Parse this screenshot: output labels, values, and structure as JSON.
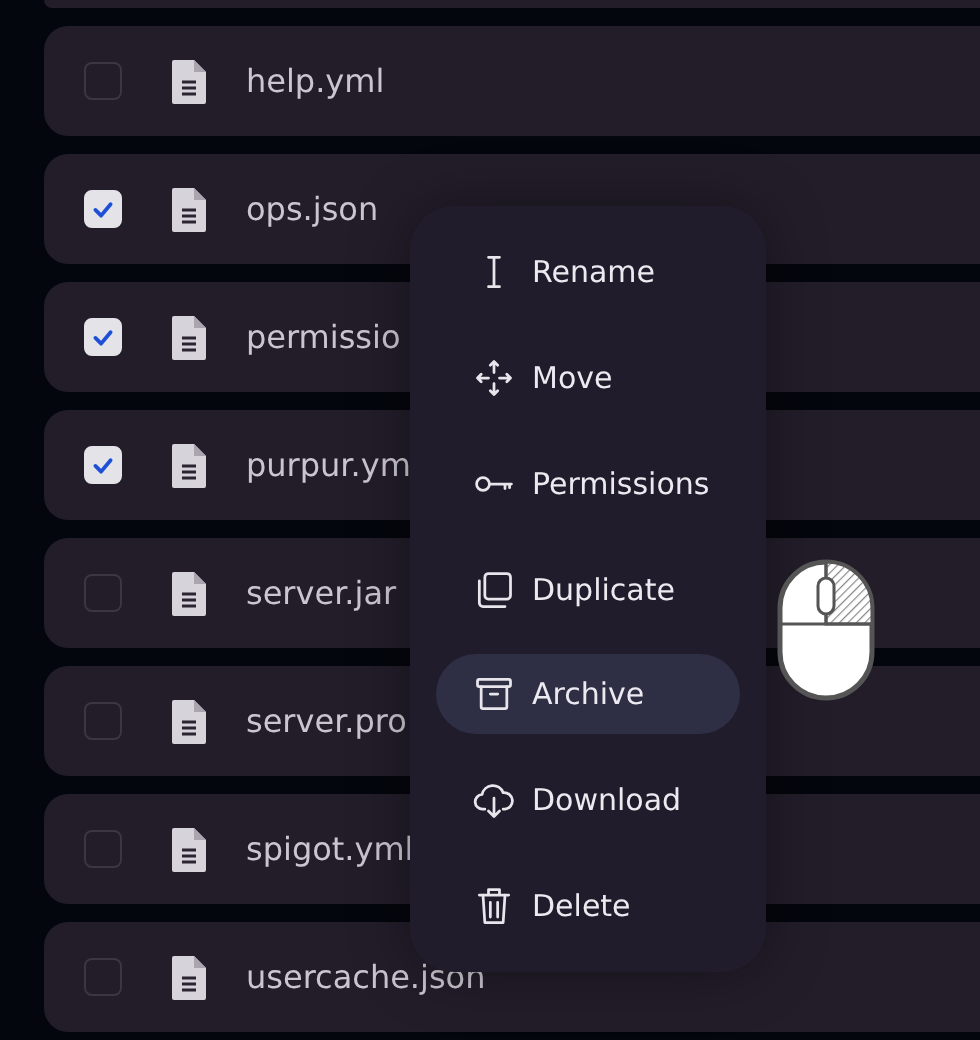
{
  "files": [
    {
      "name": "help.yml",
      "checked": false
    },
    {
      "name": "ops.json",
      "checked": true
    },
    {
      "name": "permissio",
      "checked": true
    },
    {
      "name": "purpur.ym",
      "checked": true
    },
    {
      "name": "server.jar",
      "checked": false
    },
    {
      "name": "server.pro",
      "checked": false
    },
    {
      "name": "spigot.yml",
      "checked": false
    },
    {
      "name": "usercache.json",
      "checked": false
    }
  ],
  "context_menu": [
    {
      "kind": "rename",
      "label": "Rename",
      "selected": false
    },
    {
      "kind": "move",
      "label": "Move",
      "selected": false
    },
    {
      "kind": "permissions",
      "label": "Permissions",
      "selected": false
    },
    {
      "kind": "duplicate",
      "label": "Duplicate",
      "selected": false
    },
    {
      "kind": "archive",
      "label": "Archive",
      "selected": true
    },
    {
      "kind": "download",
      "label": "Download",
      "selected": false
    },
    {
      "kind": "delete",
      "label": "Delete",
      "selected": false
    }
  ]
}
